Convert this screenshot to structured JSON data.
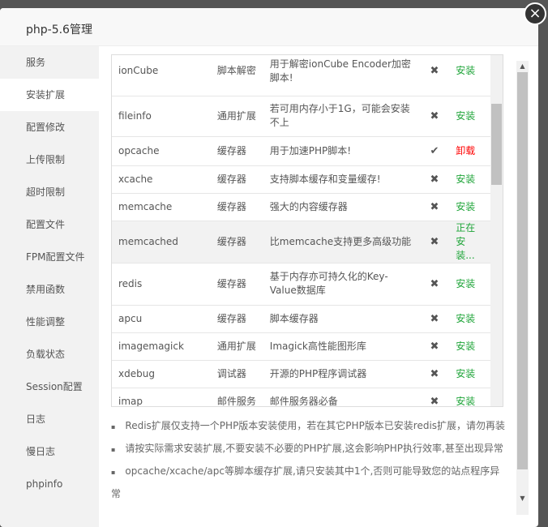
{
  "title": "php-5.6管理",
  "close_icon": "×",
  "sidebar": [
    "服务",
    "安装扩展",
    "配置修改",
    "上传限制",
    "超时限制",
    "配置文件",
    "FPM配置文件",
    "禁用函数",
    "性能调整",
    "负载状态",
    "Session配置",
    "日志",
    "慢日志",
    "phpinfo"
  ],
  "rows": [
    {
      "name": "ionCube",
      "type": "脚本解密",
      "desc": "用于解密ionCube Encoder加密脚本!",
      "status": "✖",
      "action": "安装"
    },
    {
      "name": "fileinfo",
      "type": "通用扩展",
      "desc": "若可用内存小于1G，可能会安装不上",
      "status": "✖",
      "action": "安装"
    },
    {
      "name": "opcache",
      "type": "缓存器",
      "desc": "用于加速PHP脚本!",
      "status": "✔",
      "action": "卸载"
    },
    {
      "name": "xcache",
      "type": "缓存器",
      "desc": "支持脚本缓存和变量缓存!",
      "status": "✖",
      "action": "安装"
    },
    {
      "name": "memcache",
      "type": "缓存器",
      "desc": "强大的内容缓存器",
      "status": "✖",
      "action": "安装"
    },
    {
      "name": "memcached",
      "type": "缓存器",
      "desc": "比memcache支持更多高级功能",
      "status": "✖",
      "action": "正在安装..."
    },
    {
      "name": "redis",
      "type": "缓存器",
      "desc": "基于内存亦可持久化的Key-Value数据库",
      "status": "✖",
      "action": "安装"
    },
    {
      "name": "apcu",
      "type": "缓存器",
      "desc": "脚本缓存器",
      "status": "✖",
      "action": "安装"
    },
    {
      "name": "imagemagick",
      "type": "通用扩展",
      "desc": "Imagick高性能图形库",
      "status": "✖",
      "action": "安装"
    },
    {
      "name": "xdebug",
      "type": "调试器",
      "desc": "开源的PHP程序调试器",
      "status": "✖",
      "action": "安装"
    },
    {
      "name": "imap",
      "type": "邮件服务",
      "desc": "邮件服务器必备",
      "status": "✖",
      "action": "安装"
    }
  ],
  "notes": [
    "Redis扩展仅支持一个PHP版本安装使用，若在其它PHP版本已安装redis扩展，请勿再装",
    "请按实际需求安装扩展,不要安装不必要的PHP扩展,这会影响PHP执行效率,甚至出现异常",
    "opcache/xcache/apc等脚本缓存扩展,请只安装其中1个,否则可能导致您的站点程序异常"
  ]
}
